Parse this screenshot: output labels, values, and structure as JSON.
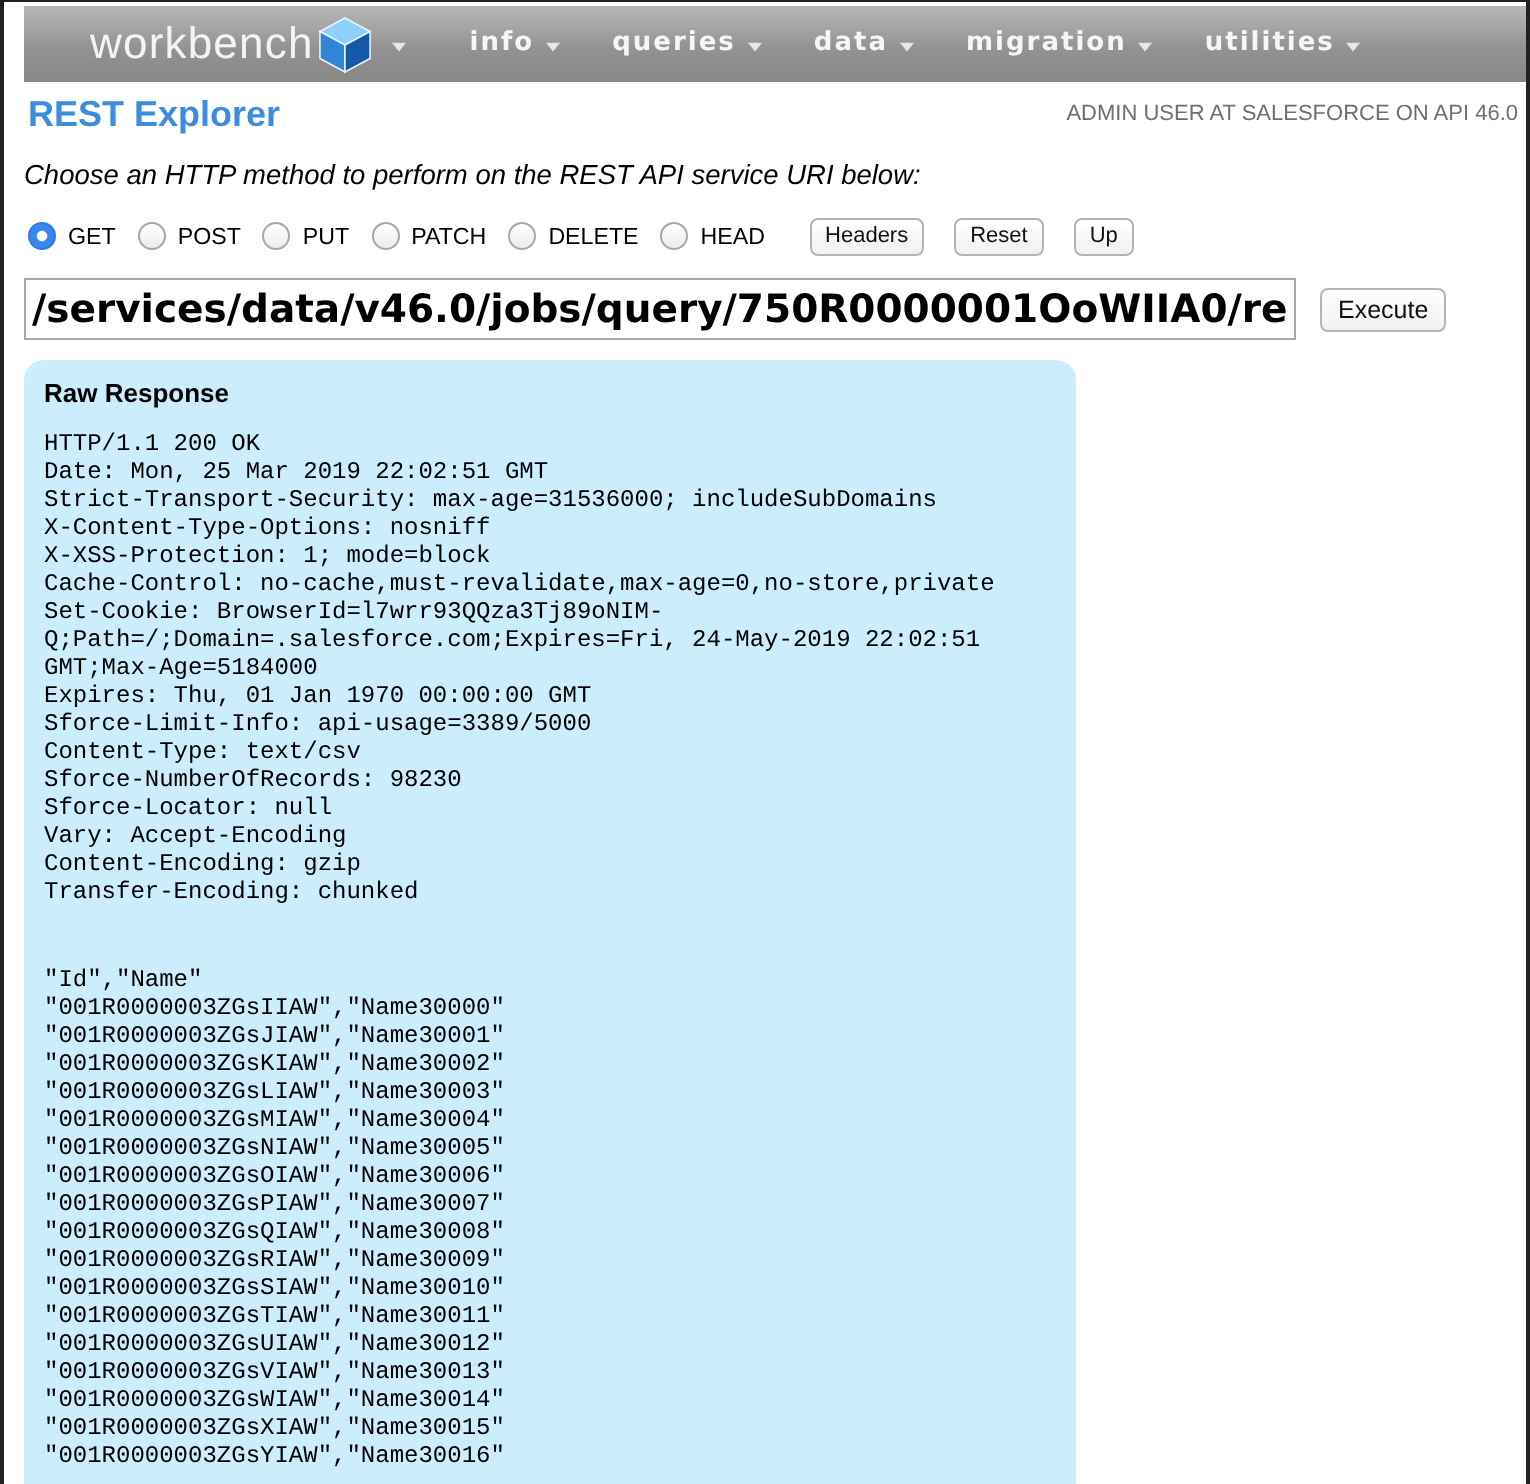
{
  "nav": {
    "logo": "workbench",
    "menus": [
      "info",
      "queries",
      "data",
      "migration",
      "utilities"
    ]
  },
  "header": {
    "title": "REST Explorer",
    "user_info": "ADMIN USER AT SALESFORCE ON API 46.0"
  },
  "instruction": "Choose an HTTP method to perform on the REST API service URI below:",
  "methods": [
    {
      "label": "GET",
      "selected": true
    },
    {
      "label": "POST",
      "selected": false
    },
    {
      "label": "PUT",
      "selected": false
    },
    {
      "label": "PATCH",
      "selected": false
    },
    {
      "label": "DELETE",
      "selected": false
    },
    {
      "label": "HEAD",
      "selected": false
    }
  ],
  "buttons": [
    "Headers",
    "Reset",
    "Up"
  ],
  "url": {
    "value": "/services/data/v46.0/jobs/query/750R0000001OoWIIA0/re"
  },
  "execute_button": "Execute",
  "response": {
    "title": "Raw Response",
    "header_lines": [
      "HTTP/1.1 200 OK",
      "Date: Mon, 25 Mar 2019 22:02:51 GMT",
      "Strict-Transport-Security: max-age=31536000; includeSubDomains",
      "X-Content-Type-Options: nosniff",
      "X-XSS-Protection: 1; mode=block",
      "Cache-Control: no-cache,must-revalidate,max-age=0,no-store,private",
      "Set-Cookie: BrowserId=l7wrr93QQza3Tj89oNIM-Q;Path=/;Domain=.salesforce.com;Expires=Fri, 24-May-2019 22:02:51 GMT;Max-Age=5184000",
      "Expires: Thu, 01 Jan 1970 00:00:00 GMT",
      "Sforce-Limit-Info: api-usage=3389/5000",
      "Content-Type: text/csv",
      "Sforce-NumberOfRecords: 98230",
      "Sforce-Locator: null",
      "Vary: Accept-Encoding",
      "Content-Encoding: gzip",
      "Transfer-Encoding: chunked"
    ],
    "body_lines": [
      "\"Id\",\"Name\"",
      "\"001R0000003ZGsIIAW\",\"Name30000\"",
      "\"001R0000003ZGsJIAW\",\"Name30001\"",
      "\"001R0000003ZGsKIAW\",\"Name30002\"",
      "\"001R0000003ZGsLIAW\",\"Name30003\"",
      "\"001R0000003ZGsMIAW\",\"Name30004\"",
      "\"001R0000003ZGsNIAW\",\"Name30005\"",
      "\"001R0000003ZGsOIAW\",\"Name30006\"",
      "\"001R0000003ZGsPIAW\",\"Name30007\"",
      "\"001R0000003ZGsQIAW\",\"Name30008\"",
      "\"001R0000003ZGsRIAW\",\"Name30009\"",
      "\"001R0000003ZGsSIAW\",\"Name30010\"",
      "\"001R0000003ZGsTIAW\",\"Name30011\"",
      "\"001R0000003ZGsUIAW\",\"Name30012\"",
      "\"001R0000003ZGsVIAW\",\"Name30013\"",
      "\"001R0000003ZGsWIAW\",\"Name30014\"",
      "\"001R0000003ZGsXIAW\",\"Name30015\"",
      "\"001R0000003ZGsYIAW\",\"Name30016\""
    ]
  }
}
